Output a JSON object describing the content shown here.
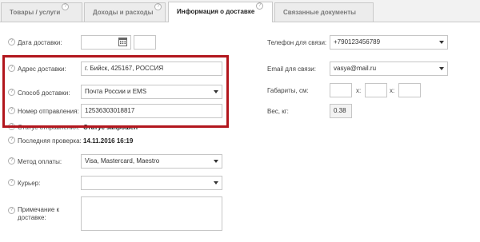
{
  "tabs": [
    {
      "label": "Товары / услуги",
      "help": "?"
    },
    {
      "label": "Доходы и расходы",
      "help": "?"
    },
    {
      "label": "Информация о доставке",
      "help": "?"
    },
    {
      "label": "Связанные документы"
    }
  ],
  "left": {
    "delivery_date": {
      "label": "Дата доставки:",
      "help": "?",
      "value": "",
      "extra": ""
    },
    "address": {
      "label": "Адрес доставки:",
      "help": "?",
      "value": "г. Бийск, 425167, РОССИЯ"
    },
    "method": {
      "label": "Способ доставки:",
      "help": "?",
      "value": "Почта России и EMS"
    },
    "tracking": {
      "label": "Номер отправления:",
      "help": "?",
      "value": "12536303018817"
    },
    "status": {
      "label": "Статус отправления:",
      "help": "?",
      "value": "Статус запрошен"
    },
    "last_check": {
      "label": "Последняя проверка:",
      "help": "?",
      "value": "14.11.2016 16:19"
    },
    "payment": {
      "label": "Метод оплаты:",
      "help": "?",
      "value": "Visa, Mastercard, Maestro"
    },
    "courier": {
      "label": "Курьер:",
      "help": "?",
      "value": ""
    },
    "note": {
      "label": "Примечание к доставке:",
      "help": "?",
      "value": ""
    }
  },
  "right": {
    "phone": {
      "label": "Телефон для связи:",
      "value": "+790123456789"
    },
    "email": {
      "label": "Email для связи:",
      "value": "vasya@mail.ru"
    },
    "dims": {
      "label": "Габариты, см:",
      "sep": "x:",
      "sep2": "x:",
      "l": "",
      "w": "",
      "h": ""
    },
    "weight": {
      "label": "Вес, кг:",
      "value": "0.38"
    }
  },
  "colors": {
    "highlight": "#b2161d",
    "border": "#c6c6c6"
  }
}
